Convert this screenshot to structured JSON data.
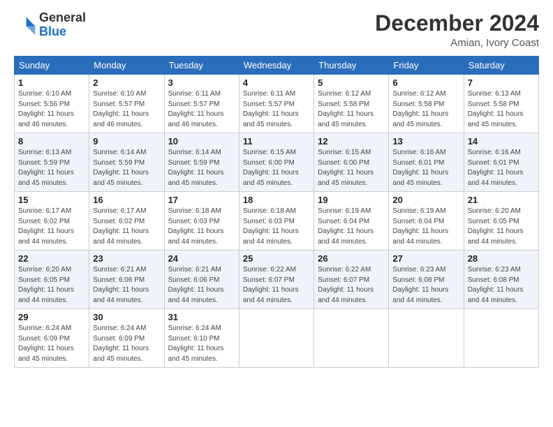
{
  "header": {
    "logo_general": "General",
    "logo_blue": "Blue",
    "month_title": "December 2024",
    "location": "Amian, Ivory Coast"
  },
  "days_of_week": [
    "Sunday",
    "Monday",
    "Tuesday",
    "Wednesday",
    "Thursday",
    "Friday",
    "Saturday"
  ],
  "weeks": [
    [
      {
        "day": "1",
        "sunrise": "6:10 AM",
        "sunset": "5:56 PM",
        "daylight": "11 hours and 46 minutes."
      },
      {
        "day": "2",
        "sunrise": "6:10 AM",
        "sunset": "5:57 PM",
        "daylight": "11 hours and 46 minutes."
      },
      {
        "day": "3",
        "sunrise": "6:11 AM",
        "sunset": "5:57 PM",
        "daylight": "11 hours and 46 minutes."
      },
      {
        "day": "4",
        "sunrise": "6:11 AM",
        "sunset": "5:57 PM",
        "daylight": "11 hours and 45 minutes."
      },
      {
        "day": "5",
        "sunrise": "6:12 AM",
        "sunset": "5:58 PM",
        "daylight": "11 hours and 45 minutes."
      },
      {
        "day": "6",
        "sunrise": "6:12 AM",
        "sunset": "5:58 PM",
        "daylight": "11 hours and 45 minutes."
      },
      {
        "day": "7",
        "sunrise": "6:13 AM",
        "sunset": "5:58 PM",
        "daylight": "11 hours and 45 minutes."
      }
    ],
    [
      {
        "day": "8",
        "sunrise": "6:13 AM",
        "sunset": "5:59 PM",
        "daylight": "11 hours and 45 minutes."
      },
      {
        "day": "9",
        "sunrise": "6:14 AM",
        "sunset": "5:59 PM",
        "daylight": "11 hours and 45 minutes."
      },
      {
        "day": "10",
        "sunrise": "6:14 AM",
        "sunset": "5:59 PM",
        "daylight": "11 hours and 45 minutes."
      },
      {
        "day": "11",
        "sunrise": "6:15 AM",
        "sunset": "6:00 PM",
        "daylight": "11 hours and 45 minutes."
      },
      {
        "day": "12",
        "sunrise": "6:15 AM",
        "sunset": "6:00 PM",
        "daylight": "11 hours and 45 minutes."
      },
      {
        "day": "13",
        "sunrise": "6:16 AM",
        "sunset": "6:01 PM",
        "daylight": "11 hours and 45 minutes."
      },
      {
        "day": "14",
        "sunrise": "6:16 AM",
        "sunset": "6:01 PM",
        "daylight": "11 hours and 44 minutes."
      }
    ],
    [
      {
        "day": "15",
        "sunrise": "6:17 AM",
        "sunset": "6:02 PM",
        "daylight": "11 hours and 44 minutes."
      },
      {
        "day": "16",
        "sunrise": "6:17 AM",
        "sunset": "6:02 PM",
        "daylight": "11 hours and 44 minutes."
      },
      {
        "day": "17",
        "sunrise": "6:18 AM",
        "sunset": "6:03 PM",
        "daylight": "11 hours and 44 minutes."
      },
      {
        "day": "18",
        "sunrise": "6:18 AM",
        "sunset": "6:03 PM",
        "daylight": "11 hours and 44 minutes."
      },
      {
        "day": "19",
        "sunrise": "6:19 AM",
        "sunset": "6:04 PM",
        "daylight": "11 hours and 44 minutes."
      },
      {
        "day": "20",
        "sunrise": "6:19 AM",
        "sunset": "6:04 PM",
        "daylight": "11 hours and 44 minutes."
      },
      {
        "day": "21",
        "sunrise": "6:20 AM",
        "sunset": "6:05 PM",
        "daylight": "11 hours and 44 minutes."
      }
    ],
    [
      {
        "day": "22",
        "sunrise": "6:20 AM",
        "sunset": "6:05 PM",
        "daylight": "11 hours and 44 minutes."
      },
      {
        "day": "23",
        "sunrise": "6:21 AM",
        "sunset": "6:06 PM",
        "daylight": "11 hours and 44 minutes."
      },
      {
        "day": "24",
        "sunrise": "6:21 AM",
        "sunset": "6:06 PM",
        "daylight": "11 hours and 44 minutes."
      },
      {
        "day": "25",
        "sunrise": "6:22 AM",
        "sunset": "6:07 PM",
        "daylight": "11 hours and 44 minutes."
      },
      {
        "day": "26",
        "sunrise": "6:22 AM",
        "sunset": "6:07 PM",
        "daylight": "11 hours and 44 minutes."
      },
      {
        "day": "27",
        "sunrise": "6:23 AM",
        "sunset": "6:08 PM",
        "daylight": "11 hours and 44 minutes."
      },
      {
        "day": "28",
        "sunrise": "6:23 AM",
        "sunset": "6:08 PM",
        "daylight": "11 hours and 44 minutes."
      }
    ],
    [
      {
        "day": "29",
        "sunrise": "6:24 AM",
        "sunset": "6:09 PM",
        "daylight": "11 hours and 45 minutes."
      },
      {
        "day": "30",
        "sunrise": "6:24 AM",
        "sunset": "6:09 PM",
        "daylight": "11 hours and 45 minutes."
      },
      {
        "day": "31",
        "sunrise": "6:24 AM",
        "sunset": "6:10 PM",
        "daylight": "11 hours and 45 minutes."
      },
      null,
      null,
      null,
      null
    ]
  ]
}
